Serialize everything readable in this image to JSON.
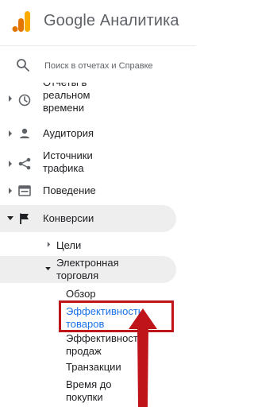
{
  "header": {
    "product_title": "Google Аналитика",
    "brand_colors": {
      "bar_light": "#fbbc04",
      "bar_dark": "#e37400"
    }
  },
  "search": {
    "placeholder": "Поиск в отчетах и Справке",
    "icon": "search-icon"
  },
  "sidebar": {
    "items": [
      {
        "label_lines": [
          "Отчеты в",
          "реальном",
          "времени"
        ],
        "icon": "clock-icon",
        "expanded": false
      },
      {
        "label": "Аудитория",
        "icon": "person-icon",
        "expanded": false
      },
      {
        "label_lines": [
          "Источники",
          "трафика"
        ],
        "icon": "acquisition-icon",
        "expanded": false
      },
      {
        "label": "Поведение",
        "icon": "behavior-icon",
        "expanded": false
      },
      {
        "label": "Конверсии",
        "icon": "flag-icon",
        "expanded": true,
        "active": true
      }
    ],
    "conversions": {
      "goals": "Цели",
      "ecommerce_lines": [
        "Электронная",
        "торговля"
      ],
      "ecommerce_children": [
        {
          "label": "Обзор"
        },
        {
          "label_lines": [
            "Эффективность",
            "товаров"
          ],
          "selected": true
        },
        {
          "label_lines": [
            "Эффективность",
            "продаж"
          ]
        },
        {
          "label": "Транзакции"
        },
        {
          "label_lines": [
            "Время до",
            "покупки"
          ]
        }
      ]
    }
  },
  "annotation": {
    "highlight_color": "#c0141b"
  }
}
